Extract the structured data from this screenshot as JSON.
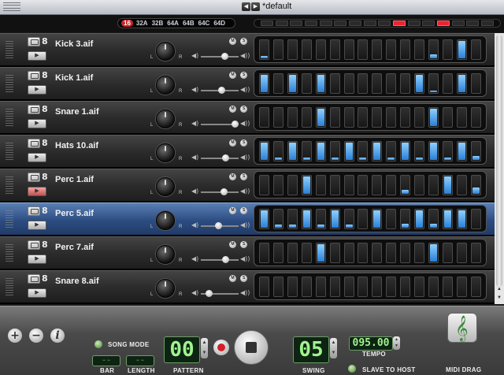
{
  "window": {
    "title": "*default",
    "nav_prev": "◀",
    "nav_next": "▶"
  },
  "pattern_banks": [
    {
      "label": "16",
      "active": true
    },
    {
      "label": "32A",
      "active": false
    },
    {
      "label": "32B",
      "active": false
    },
    {
      "label": "64A",
      "active": false
    },
    {
      "label": "64B",
      "active": false
    },
    {
      "label": "64C",
      "active": false
    },
    {
      "label": "64D",
      "active": false
    }
  ],
  "step_indicator": [
    0,
    0,
    0,
    0,
    0,
    0,
    0,
    0,
    0,
    1,
    0,
    0,
    1,
    0,
    0,
    0
  ],
  "tracks": [
    {
      "name": "Kick 3.aif",
      "selected": false,
      "play_red": false,
      "volume": 0.62,
      "mute": "M",
      "solo": "S",
      "steps": [
        0.2,
        0,
        0,
        0,
        0,
        0,
        0,
        0,
        0,
        0,
        0,
        0,
        0.3,
        0,
        1,
        0
      ]
    },
    {
      "name": "Kick 1.aif",
      "selected": false,
      "play_red": false,
      "volume": 0.55,
      "mute": "M",
      "solo": "S",
      "steps": [
        1,
        0,
        1,
        0,
        1,
        0,
        0,
        0,
        0,
        0,
        0,
        1,
        0.15,
        0,
        1,
        0
      ]
    },
    {
      "name": "Snare 1.aif",
      "selected": false,
      "play_red": false,
      "volume": 0.9,
      "mute": "M",
      "solo": "S",
      "steps": [
        0,
        0,
        0,
        0,
        1,
        0,
        0,
        0,
        0,
        0,
        0,
        0,
        1,
        0,
        0,
        0
      ]
    },
    {
      "name": "Hats 10.aif",
      "selected": false,
      "play_red": false,
      "volume": 0.65,
      "mute": "M",
      "solo": "S",
      "steps": [
        1,
        0.2,
        1,
        0.2,
        1,
        0.2,
        1,
        0.2,
        1,
        0.2,
        1,
        0.2,
        1,
        0.2,
        1,
        0.3
      ]
    },
    {
      "name": "Perc 1.aif",
      "selected": false,
      "play_red": true,
      "volume": 0.6,
      "mute": "M",
      "solo": "S",
      "steps": [
        0,
        0,
        0,
        1,
        0,
        0,
        0,
        0,
        0,
        0,
        0.3,
        0,
        0,
        1,
        0,
        0.4
      ]
    },
    {
      "name": "Perc 5.aif",
      "selected": true,
      "play_red": false,
      "volume": 0.45,
      "mute": "M",
      "solo": "S",
      "steps": [
        1,
        0.25,
        0.25,
        1,
        0.25,
        1,
        0.25,
        0,
        1,
        0,
        0.3,
        1,
        0.3,
        1,
        1,
        0
      ]
    },
    {
      "name": "Perc 7.aif",
      "selected": false,
      "play_red": false,
      "volume": 0.65,
      "mute": "M",
      "solo": "S",
      "steps": [
        0,
        0,
        0,
        0,
        1,
        0,
        0,
        0,
        0,
        0,
        0,
        0,
        1,
        0,
        0,
        0
      ]
    },
    {
      "name": "Snare 8.aif",
      "selected": false,
      "play_red": false,
      "volume": 0.2,
      "mute": "M",
      "solo": "S",
      "steps": [
        0,
        0,
        0,
        0,
        0,
        0,
        0,
        0,
        0,
        0,
        0,
        0,
        0,
        0,
        0,
        0
      ]
    }
  ],
  "track_labels": {
    "left": "L",
    "right": "R",
    "number": "8"
  },
  "transport": {
    "add": "+",
    "remove": "−",
    "info": "i",
    "song_mode": "SONG MODE",
    "bar_label": "BAR",
    "bar_value": "--",
    "length_label": "LENGTH",
    "length_value": "--",
    "pattern_label": "PATTERN",
    "pattern_value": "00",
    "swing_label": "SWING",
    "swing_value": "05",
    "tempo_label": "TEMPO",
    "tempo_value": "095.00",
    "slave_label": "SLAVE TO HOST",
    "midi_drag_label": "MIDI DRAG"
  },
  "colors": {
    "pad_on": "#2a7fd6",
    "selected_track": "#2c4d82",
    "record": "#d0202a",
    "lcd": "#9ff38e"
  }
}
